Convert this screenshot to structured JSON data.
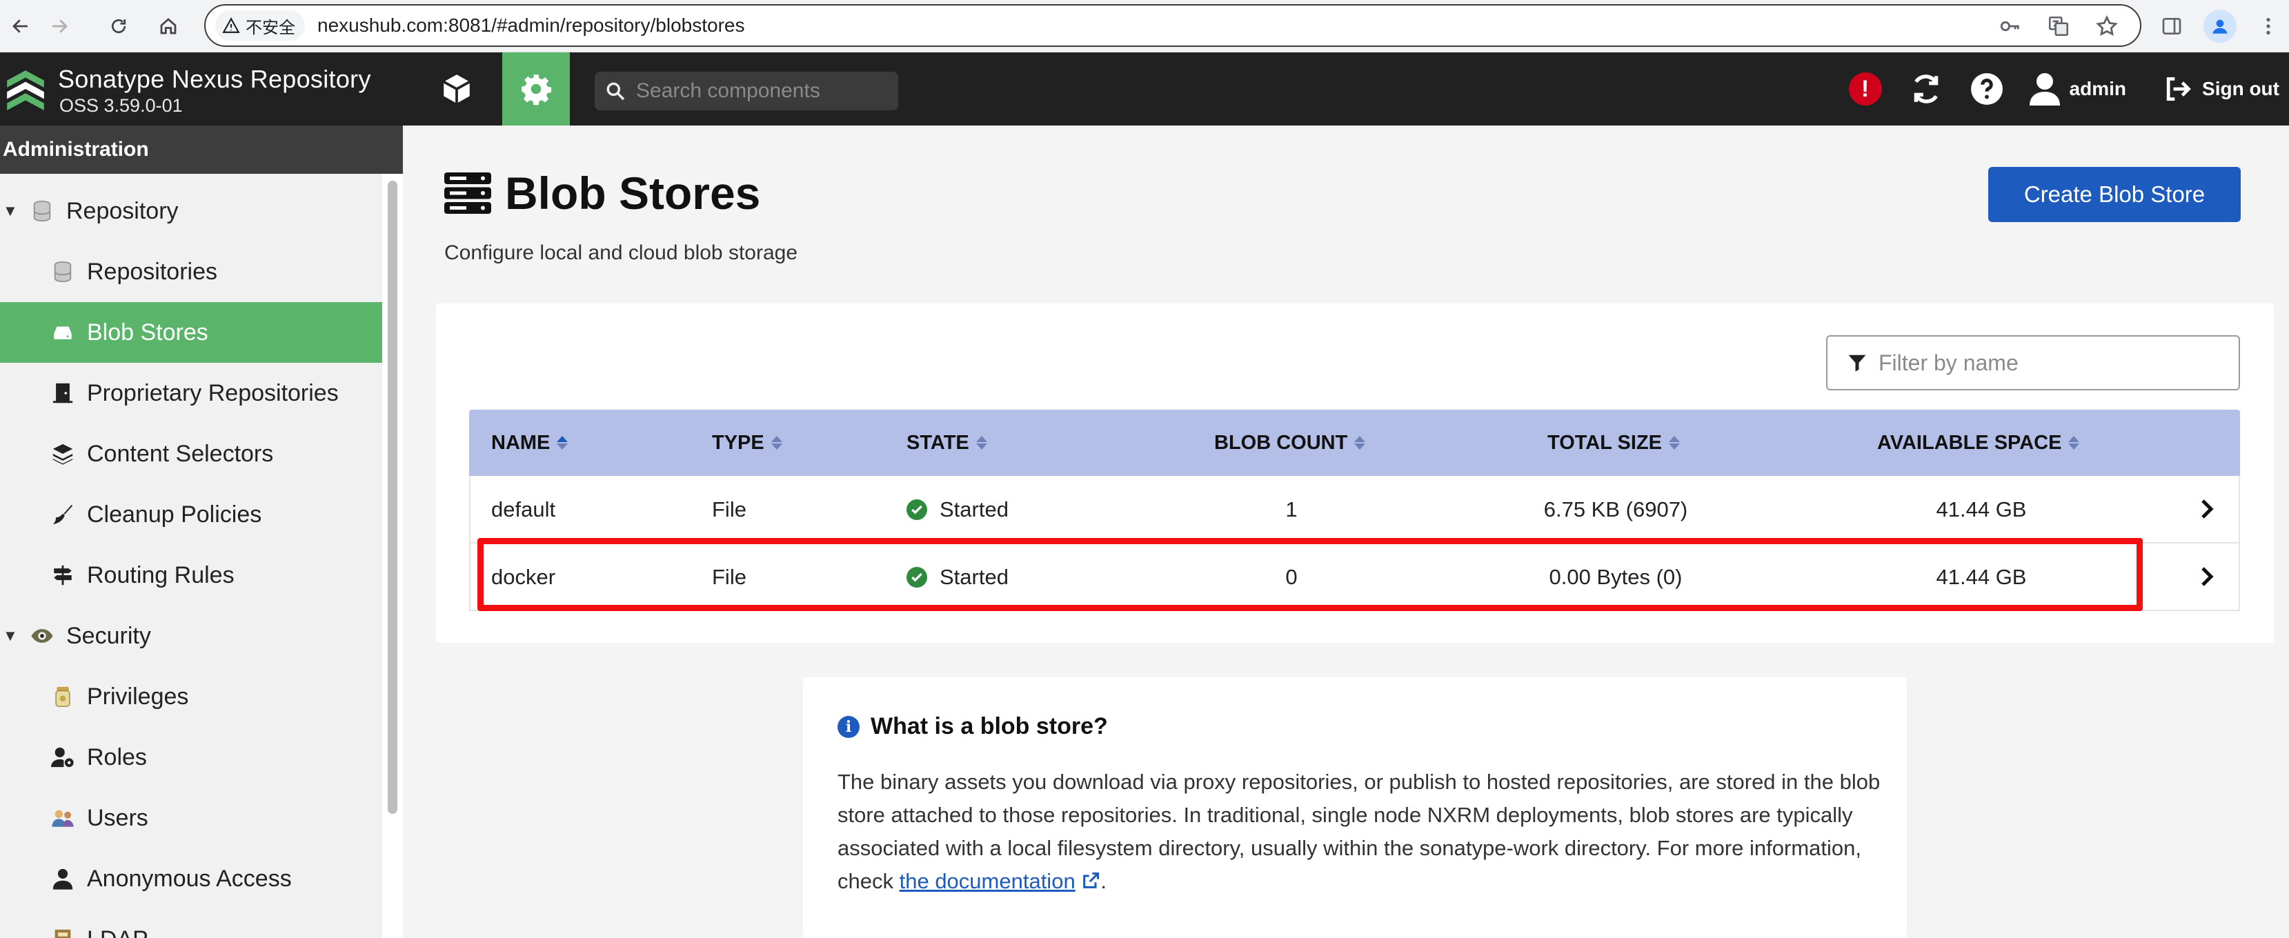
{
  "browser": {
    "security_label": "不安全",
    "url": "nexushub.com:8081/#admin/repository/blobstores"
  },
  "header": {
    "brand_title": "Sonatype Nexus Repository",
    "brand_version": "OSS 3.59.0-01",
    "search_placeholder": "Search components",
    "alert_glyph": "!",
    "user_label": "admin",
    "signout_label": "Sign out"
  },
  "sidebar": {
    "title": "Administration",
    "items": [
      {
        "label": "Repository",
        "icon": "database-icon"
      },
      {
        "label": "Repositories",
        "icon": "database-icon"
      },
      {
        "label": "Blob Stores",
        "icon": "hard-drive-icon"
      },
      {
        "label": "Proprietary Repositories",
        "icon": "door-icon"
      },
      {
        "label": "Content Selectors",
        "icon": "layers-icon"
      },
      {
        "label": "Cleanup Policies",
        "icon": "broom-icon"
      },
      {
        "label": "Routing Rules",
        "icon": "signpost-icon"
      },
      {
        "label": "Security",
        "icon": "eye-icon"
      },
      {
        "label": "Privileges",
        "icon": "badge-icon"
      },
      {
        "label": "Roles",
        "icon": "user-gear-icon"
      },
      {
        "label": "Users",
        "icon": "users-icon"
      },
      {
        "label": "Anonymous Access",
        "icon": "user-icon"
      },
      {
        "label": "LDAP",
        "icon": "book-icon"
      }
    ]
  },
  "main": {
    "title": "Blob Stores",
    "subtitle": "Configure local and cloud blob storage",
    "create_button": "Create Blob Store",
    "filter_placeholder": "Filter by name",
    "columns": {
      "name": "NAME",
      "type": "TYPE",
      "state": "STATE",
      "blob_count": "BLOB COUNT",
      "total_size": "TOTAL SIZE",
      "available_space": "AVAILABLE SPACE"
    },
    "rows": [
      {
        "name": "default",
        "type": "File",
        "state": "Started",
        "blob_count": "1",
        "total_size": "6.75 KB (6907)",
        "available_space": "41.44 GB"
      },
      {
        "name": "docker",
        "type": "File",
        "state": "Started",
        "blob_count": "0",
        "total_size": "0.00 Bytes (0)",
        "available_space": "41.44 GB"
      }
    ]
  },
  "info": {
    "title": "What is a blob store?",
    "body_1": "The binary assets you download via proxy repositories, or publish to hosted repositories, are stored in the blob store attached to those repositories. In traditional, single node NXRM deployments, blob stores are typically associated with a local filesystem directory, usually within the sonatype-work directory. For more information, check ",
    "link_text": "the documentation",
    "body_2": "."
  },
  "colors": {
    "brand_green": "#5ab56b",
    "header_dark": "#212121",
    "primary_blue": "#1d5bbf",
    "table_header": "#b3bfe6",
    "highlight_red": "#f10f0f",
    "alert_red": "#d0021b"
  }
}
